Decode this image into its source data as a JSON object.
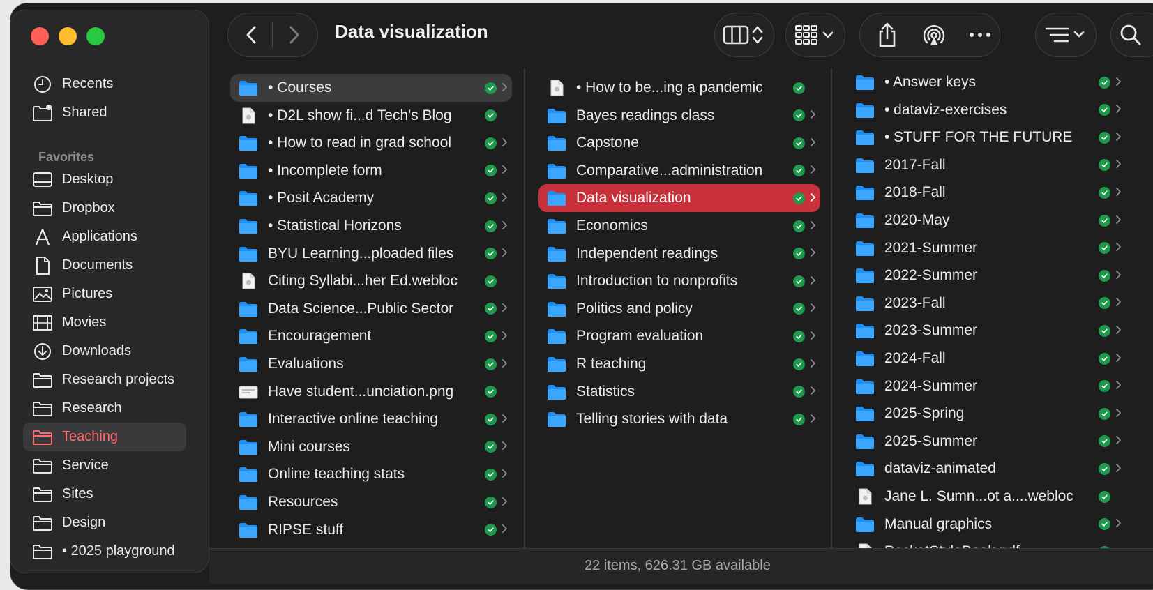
{
  "window": {
    "title": "Data visualization",
    "status": "22 items, 626.31 GB available"
  },
  "sidebar": {
    "top_items": [
      {
        "label": "Recents",
        "icon": "clock-icon"
      },
      {
        "label": "Shared",
        "icon": "shared-folder-icon"
      }
    ],
    "favorites_header": "Favorites",
    "favorites": [
      {
        "label": "Desktop",
        "icon": "desktop-icon"
      },
      {
        "label": "Dropbox",
        "icon": "folder-icon"
      },
      {
        "label": "Applications",
        "icon": "applications-icon"
      },
      {
        "label": "Documents",
        "icon": "document-icon"
      },
      {
        "label": "Pictures",
        "icon": "pictures-icon"
      },
      {
        "label": "Movies",
        "icon": "film-icon"
      },
      {
        "label": "Downloads",
        "icon": "download-icon"
      },
      {
        "label": "Research projects",
        "icon": "folder-icon"
      },
      {
        "label": "Research",
        "icon": "folder-icon"
      },
      {
        "label": "Teaching",
        "icon": "folder-icon",
        "selected": true
      },
      {
        "label": "Service",
        "icon": "folder-icon"
      },
      {
        "label": "Sites",
        "icon": "folder-icon"
      },
      {
        "label": "Design",
        "icon": "folder-icon"
      },
      {
        "label": "• 2025 playground",
        "icon": "folder-icon"
      }
    ]
  },
  "columns": [
    {
      "items": [
        {
          "name": "• Courses",
          "type": "folder",
          "chevron": true,
          "selected": "grey"
        },
        {
          "name": "• D2L show fi...d Tech's Blog",
          "type": "file",
          "chevron": false
        },
        {
          "name": "• How to read in grad school",
          "type": "folder",
          "chevron": true
        },
        {
          "name": "• Incomplete form",
          "type": "folder",
          "chevron": true
        },
        {
          "name": "• Posit Academy",
          "type": "folder",
          "chevron": true
        },
        {
          "name": "• Statistical Horizons",
          "type": "folder",
          "chevron": true
        },
        {
          "name": "BYU Learning...ploaded files",
          "type": "folder",
          "chevron": true
        },
        {
          "name": "Citing Syllabi...her Ed.webloc",
          "type": "file",
          "chevron": false
        },
        {
          "name": "Data Science...Public Sector",
          "type": "folder",
          "chevron": true
        },
        {
          "name": "Encouragement",
          "type": "folder",
          "chevron": true
        },
        {
          "name": "Evaluations",
          "type": "folder",
          "chevron": true
        },
        {
          "name": "Have student...unciation.png",
          "type": "image",
          "chevron": false
        },
        {
          "name": "Interactive online teaching",
          "type": "folder",
          "chevron": true
        },
        {
          "name": "Mini courses",
          "type": "folder",
          "chevron": true
        },
        {
          "name": "Online teaching stats",
          "type": "folder",
          "chevron": true
        },
        {
          "name": "Resources",
          "type": "folder",
          "chevron": true
        },
        {
          "name": "RIPSE stuff",
          "type": "folder",
          "chevron": true
        }
      ]
    },
    {
      "items": [
        {
          "name": "• How to be...ing a pandemic",
          "type": "file",
          "chevron": false
        },
        {
          "name": "Bayes readings class",
          "type": "folder",
          "chevron": true
        },
        {
          "name": "Capstone",
          "type": "folder",
          "chevron": true
        },
        {
          "name": "Comparative...administration",
          "type": "folder",
          "chevron": true
        },
        {
          "name": "Data visualization",
          "type": "folder",
          "chevron": true,
          "selected": "red"
        },
        {
          "name": "Economics",
          "type": "folder",
          "chevron": true
        },
        {
          "name": "Independent readings",
          "type": "folder",
          "chevron": true
        },
        {
          "name": "Introduction to nonprofits",
          "type": "folder",
          "chevron": true
        },
        {
          "name": "Politics and policy",
          "type": "folder",
          "chevron": true
        },
        {
          "name": "Program evaluation",
          "type": "folder",
          "chevron": true
        },
        {
          "name": "R teaching",
          "type": "folder",
          "chevron": true
        },
        {
          "name": "Statistics",
          "type": "folder",
          "chevron": true
        },
        {
          "name": "Telling stories with data",
          "type": "folder",
          "chevron": true
        }
      ]
    },
    {
      "items": [
        {
          "name": "• Answer keys",
          "type": "folder",
          "chevron": true
        },
        {
          "name": "• dataviz-exercises",
          "type": "folder",
          "chevron": true
        },
        {
          "name": "• STUFF FOR THE FUTURE",
          "type": "folder",
          "chevron": true
        },
        {
          "name": "2017-Fall",
          "type": "folder",
          "chevron": true
        },
        {
          "name": "2018-Fall",
          "type": "folder",
          "chevron": true
        },
        {
          "name": "2020-May",
          "type": "folder",
          "chevron": true
        },
        {
          "name": "2021-Summer",
          "type": "folder",
          "chevron": true
        },
        {
          "name": "2022-Summer",
          "type": "folder",
          "chevron": true
        },
        {
          "name": "2023-Fall",
          "type": "folder",
          "chevron": true
        },
        {
          "name": "2023-Summer",
          "type": "folder",
          "chevron": true
        },
        {
          "name": "2024-Fall",
          "type": "folder",
          "chevron": true
        },
        {
          "name": "2024-Summer",
          "type": "folder",
          "chevron": true
        },
        {
          "name": "2025-Spring",
          "type": "folder",
          "chevron": true
        },
        {
          "name": "2025-Summer",
          "type": "folder",
          "chevron": true
        },
        {
          "name": "dataviz-animated",
          "type": "folder",
          "chevron": true
        },
        {
          "name": "Jane L. Sumn...ot a....webloc",
          "type": "file",
          "chevron": false
        },
        {
          "name": "Manual graphics",
          "type": "folder",
          "chevron": true
        },
        {
          "name": "PocketStyleBook.pdf",
          "type": "file",
          "chevron": false
        }
      ]
    }
  ],
  "colors": {
    "folder": "#1e8ff5",
    "sync_check": "#1f9a4d",
    "selection_red": "#c8313a",
    "sidebar_selected_text": "#ff6b6b"
  }
}
